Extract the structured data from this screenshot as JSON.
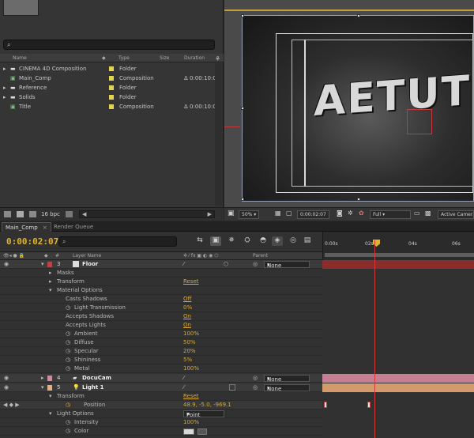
{
  "project": {
    "columns": {
      "name": "Name",
      "type": "Type",
      "size": "Size",
      "duration": "Duration"
    },
    "items": [
      {
        "name": "CINEMA 4D Composition",
        "type": "Folder",
        "duration": ""
      },
      {
        "name": "Main_Comp",
        "type": "Composition",
        "duration": "Δ 0:00:10:0"
      },
      {
        "name": "Reference",
        "type": "Folder",
        "duration": ""
      },
      {
        "name": "Solids",
        "type": "Folder",
        "duration": ""
      },
      {
        "name": "Title",
        "type": "Composition",
        "duration": "Δ 0:00:10:0"
      }
    ],
    "bpc": "16 bpc",
    "colors": {
      "swatch": "#e2d650",
      "label_red": "#d23a3a",
      "label_pink": "#d48a9a"
    }
  },
  "viewer": {
    "canvas_text": "AETUT",
    "zoom": "50%",
    "timecode": "0:00:02:07",
    "resolution": "Full",
    "camera": "Active Camera"
  },
  "tabs": [
    {
      "label": "Main_Comp"
    },
    {
      "label": "Render Queue"
    }
  ],
  "timeline": {
    "timecode": "0:00:02:07",
    "columns": {
      "layer_name": "Layer Name",
      "parent": "Parent",
      "hash": "#"
    },
    "ruler": [
      "0:00s",
      "02s",
      "04s",
      "06s"
    ],
    "rows": [
      {
        "num": "3",
        "name": "Floor",
        "parent": "None",
        "kind": "layer"
      },
      {
        "name": "Masks",
        "kind": "group"
      },
      {
        "name": "Transform",
        "value": "Reset",
        "kind": "group"
      },
      {
        "name": "Material Options",
        "kind": "group"
      },
      {
        "name": "Casts Shadows",
        "value": "Off",
        "kind": "prop"
      },
      {
        "name": "Light Transmission",
        "value": "0%",
        "kind": "prop"
      },
      {
        "name": "Accepts Shadows",
        "value": "On",
        "kind": "prop"
      },
      {
        "name": "Accepts Lights",
        "value": "On",
        "kind": "prop"
      },
      {
        "name": "Ambient",
        "value": "100%",
        "kind": "prop"
      },
      {
        "name": "Diffuse",
        "value": "50%",
        "kind": "prop"
      },
      {
        "name": "Specular",
        "value": "20%",
        "kind": "prop"
      },
      {
        "name": "Shininess",
        "value": "5%",
        "kind": "prop"
      },
      {
        "name": "Metal",
        "value": "100%",
        "kind": "prop"
      },
      {
        "num": "4",
        "name": "DocuCam",
        "parent": "None",
        "kind": "layer"
      },
      {
        "num": "5",
        "name": "Light 1",
        "parent": "None",
        "kind": "layer"
      },
      {
        "name": "Transform",
        "value": "Reset",
        "kind": "group"
      },
      {
        "name": "Position",
        "value": "48.9, -5.0, -969.1",
        "kind": "prop"
      },
      {
        "name": "Light Options",
        "value": "Point",
        "kind": "group"
      },
      {
        "name": "Intensity",
        "value": "100%",
        "kind": "prop"
      },
      {
        "name": "Color",
        "value": "",
        "kind": "prop"
      }
    ]
  }
}
